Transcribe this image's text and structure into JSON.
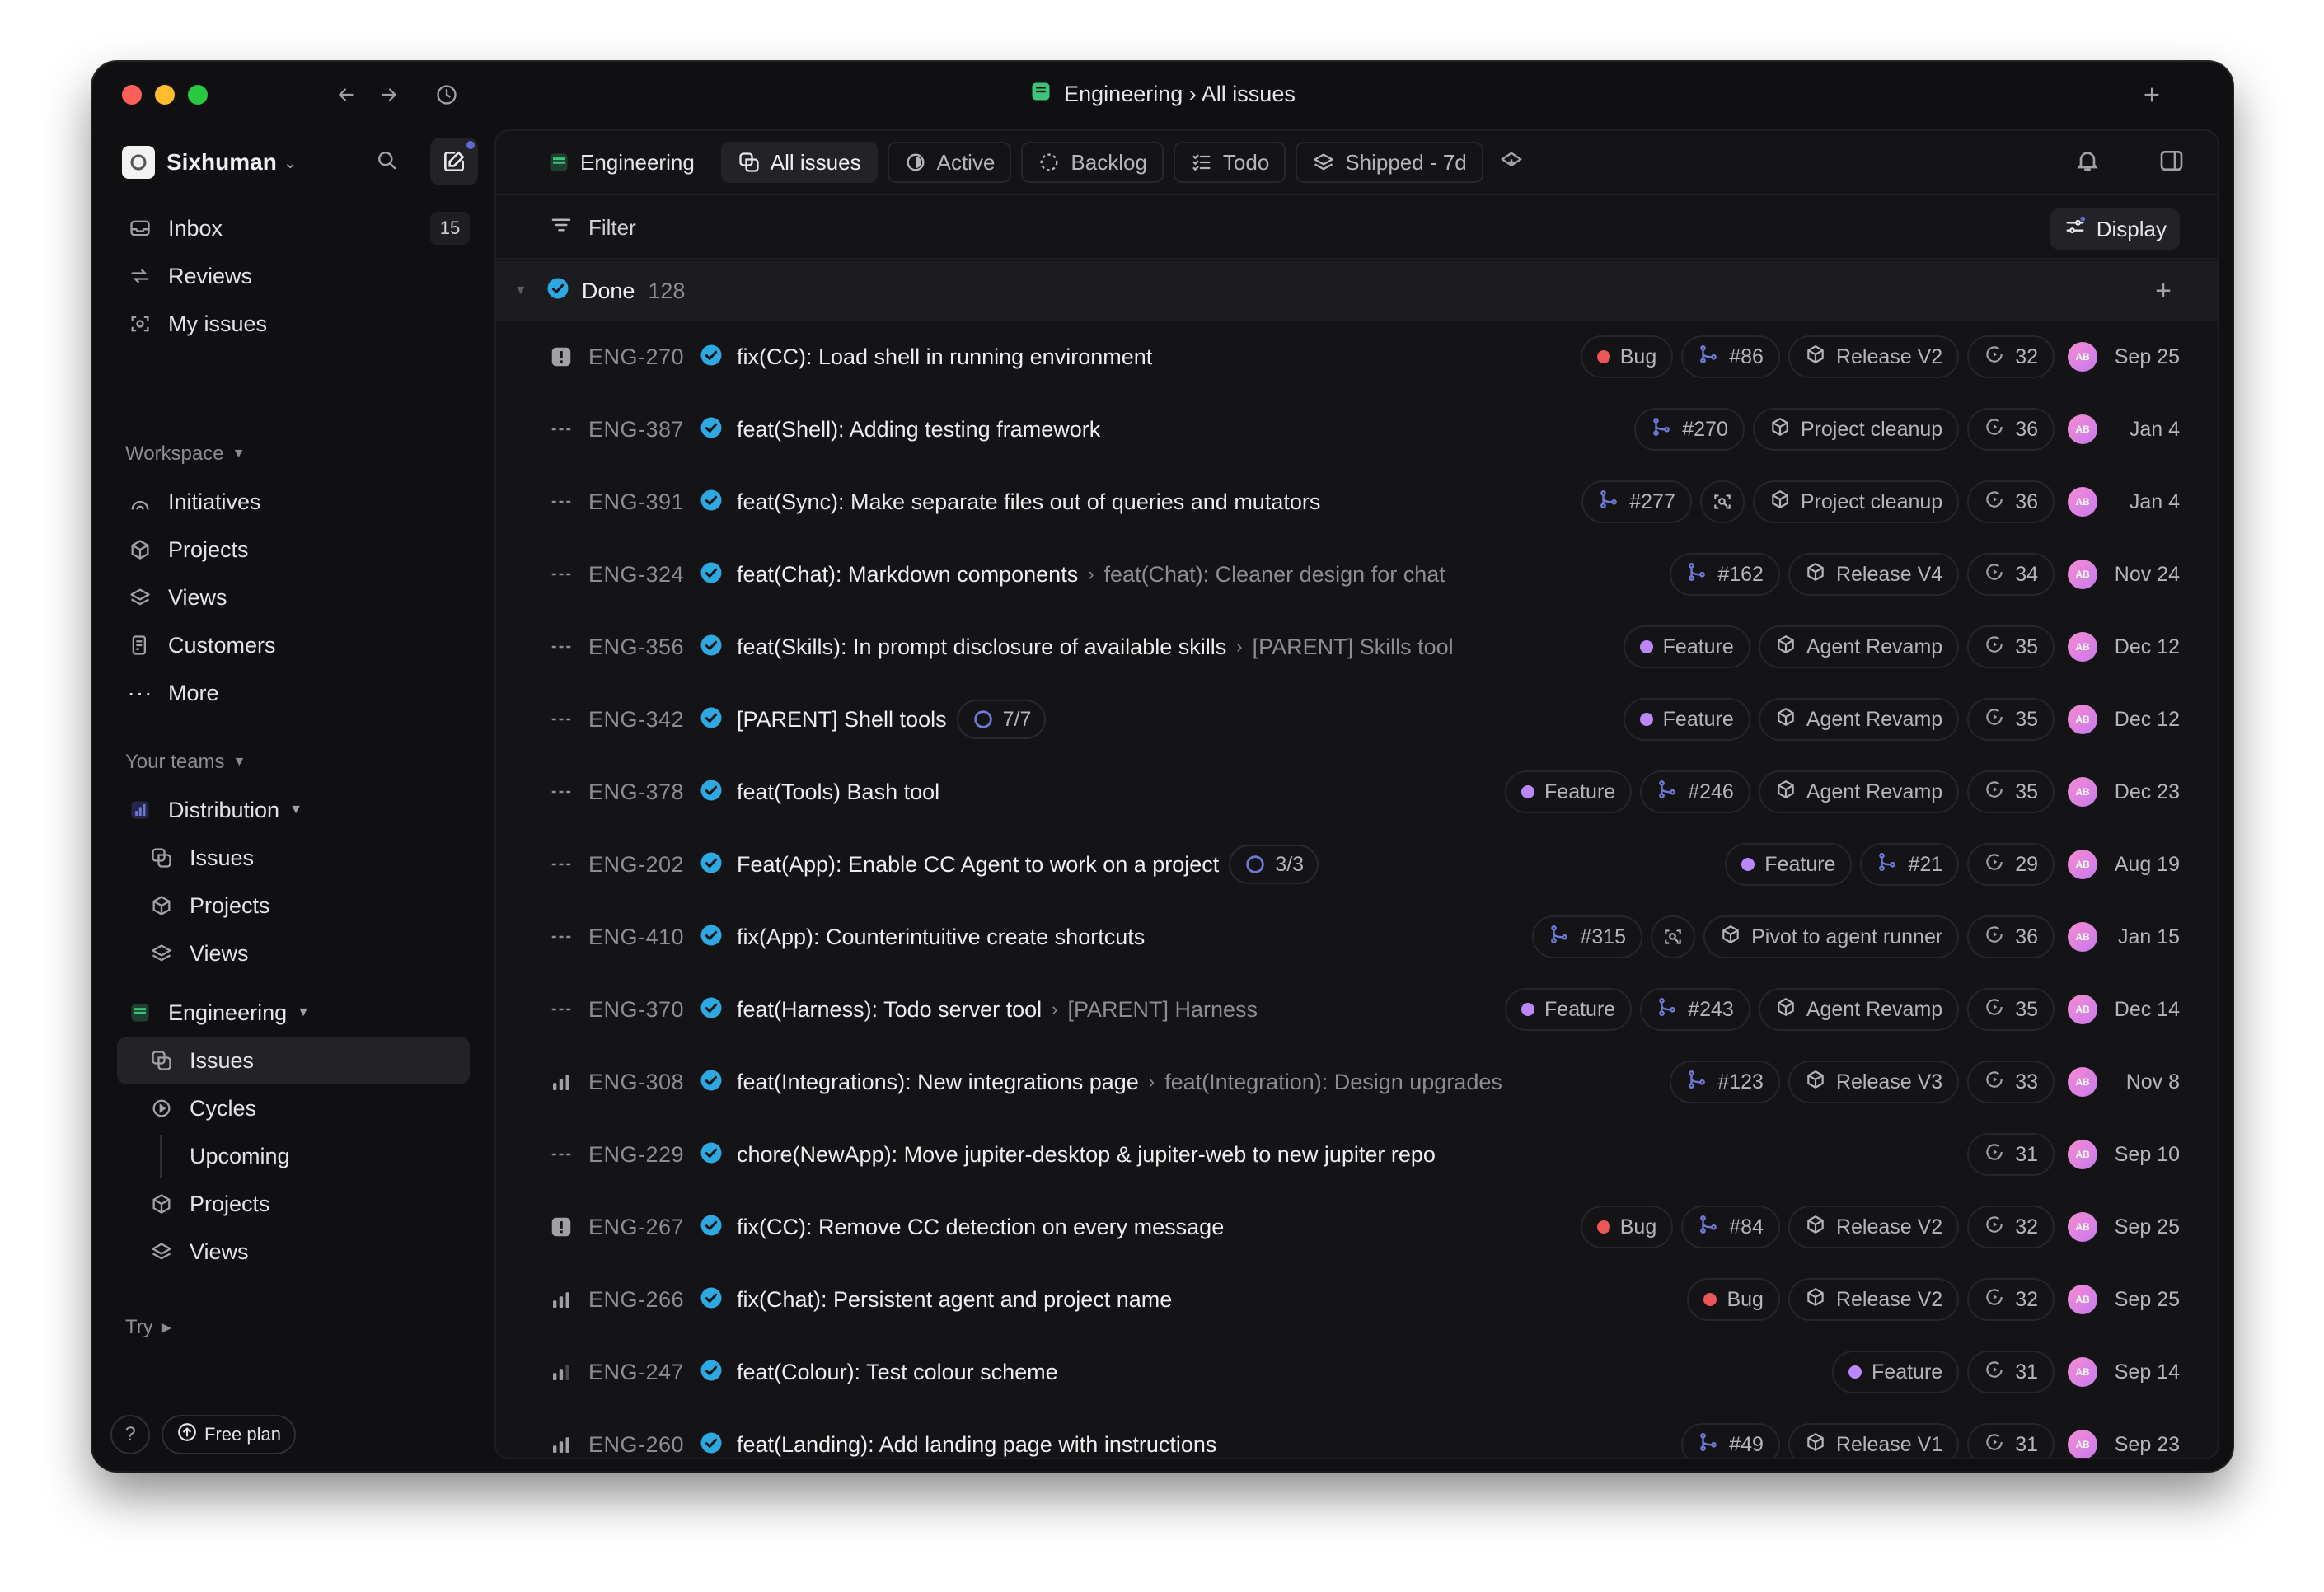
{
  "window": {
    "title_team": "Engineering",
    "title_sep": "›",
    "title_view": "All issues"
  },
  "sidebar": {
    "workspace_name": "Sixhuman",
    "top_items": [
      {
        "label": "Inbox",
        "count": "15"
      },
      {
        "label": "Reviews"
      },
      {
        "label": "My issues"
      }
    ],
    "workspace_header": "Workspace",
    "workspace_items": [
      "Initiatives",
      "Projects",
      "Views",
      "Customers",
      "More"
    ],
    "teams_header": "Your teams",
    "distribution": {
      "label": "Distribution",
      "items": [
        "Issues",
        "Projects",
        "Views"
      ]
    },
    "engineering": {
      "label": "Engineering",
      "items": [
        "Issues",
        "Cycles",
        "Upcoming",
        "Projects",
        "Views"
      ]
    },
    "try_label": "Try",
    "help_label": "?",
    "plan_label": "Free plan"
  },
  "tabs": {
    "team": "Engineering",
    "items": [
      "All issues",
      "Active",
      "Backlog",
      "Todo",
      "Shipped - 7d"
    ]
  },
  "filterbar": {
    "filter_label": "Filter",
    "display_label": "Display"
  },
  "group": {
    "label": "Done",
    "count": "128"
  },
  "colors": {
    "accent": "#5e6ad2",
    "done": "#2ea8e0",
    "bug": "#eb5757",
    "feature": "#bb87fc",
    "pr": "#6e79d6"
  },
  "issues": [
    {
      "priority": "urgent",
      "id": "ENG-270",
      "title": "fix(CC): Load shell in running environment",
      "label": "Bug",
      "label_color": "#eb5757",
      "pr": "#86",
      "project": "Release V2",
      "cycle": "32",
      "avatar": "AB",
      "date": "Sep 25"
    },
    {
      "priority": "none",
      "id": "ENG-387",
      "title": "feat(Shell): Adding testing framework",
      "pr": "#270",
      "project": "Project cleanup",
      "cycle": "36",
      "avatar": "AB",
      "date": "Jan 4"
    },
    {
      "priority": "none",
      "id": "ENG-391",
      "title": "feat(Sync): Make separate files out of queries and mutators",
      "pr": "#277",
      "review": true,
      "project": "Project cleanup",
      "cycle": "36",
      "avatar": "AB",
      "date": "Jan 4"
    },
    {
      "priority": "none",
      "id": "ENG-324",
      "title": "feat(Chat): Markdown components",
      "parent": "feat(Chat): Cleaner design for chat",
      "pr": "#162",
      "project": "Release V4",
      "cycle": "34",
      "avatar": "AB",
      "date": "Nov 24"
    },
    {
      "priority": "none",
      "id": "ENG-356",
      "title": "feat(Skills): In prompt disclosure of available skills",
      "parent": "[PARENT] Skills tool",
      "label": "Feature",
      "label_color": "#bb87fc",
      "project": "Agent Revamp",
      "cycle": "35",
      "avatar": "AB",
      "date": "Dec 12"
    },
    {
      "priority": "none",
      "id": "ENG-342",
      "title": "[PARENT] Shell tools",
      "subcount": "7/7",
      "label": "Feature",
      "label_color": "#bb87fc",
      "project": "Agent Revamp",
      "cycle": "35",
      "avatar": "AB",
      "date": "Dec 12"
    },
    {
      "priority": "none",
      "id": "ENG-378",
      "title": "feat(Tools) Bash tool",
      "label": "Feature",
      "label_color": "#bb87fc",
      "pr": "#246",
      "project": "Agent Revamp",
      "cycle": "35",
      "avatar": "AB",
      "date": "Dec 23"
    },
    {
      "priority": "none",
      "id": "ENG-202",
      "title": "Feat(App): Enable CC Agent to work on a project",
      "subcount": "3/3",
      "label": "Feature",
      "label_color": "#bb87fc",
      "pr": "#21",
      "cycle": "29",
      "avatar": "AB",
      "date": "Aug 19"
    },
    {
      "priority": "none",
      "id": "ENG-410",
      "title": "fix(App): Counterintuitive create shortcuts",
      "pr": "#315",
      "review": true,
      "project": "Pivot to agent runner",
      "cycle": "36",
      "avatar": "AB",
      "date": "Jan 15"
    },
    {
      "priority": "none",
      "id": "ENG-370",
      "title": "feat(Harness): Todo server tool",
      "parent": "[PARENT] Harness",
      "label": "Feature",
      "label_color": "#bb87fc",
      "pr": "#243",
      "project": "Agent Revamp",
      "cycle": "35",
      "avatar": "AB",
      "date": "Dec 14"
    },
    {
      "priority": "high",
      "id": "ENG-308",
      "title": "feat(Integrations): New integrations page",
      "parent": "feat(Integration): Design upgrades",
      "pr": "#123",
      "project": "Release V3",
      "cycle": "33",
      "avatar": "AB",
      "date": "Nov 8"
    },
    {
      "priority": "none",
      "id": "ENG-229",
      "title": "chore(NewApp): Move jupiter-desktop & jupiter-web to new jupiter repo",
      "cycle": "31",
      "avatar": "AB",
      "date": "Sep 10"
    },
    {
      "priority": "urgent",
      "id": "ENG-267",
      "title": "fix(CC): Remove CC detection on every message",
      "label": "Bug",
      "label_color": "#eb5757",
      "pr": "#84",
      "project": "Release V2",
      "cycle": "32",
      "avatar": "AB",
      "date": "Sep 25"
    },
    {
      "priority": "high",
      "id": "ENG-266",
      "title": "fix(Chat): Persistent agent and project name",
      "label": "Bug",
      "label_color": "#eb5757",
      "project": "Release V2",
      "cycle": "32",
      "avatar": "AB",
      "date": "Sep 25"
    },
    {
      "priority": "medium",
      "id": "ENG-247",
      "title": "feat(Colour): Test colour scheme",
      "label": "Feature",
      "label_color": "#bb87fc",
      "cycle": "31",
      "avatar": "AB",
      "date": "Sep 14"
    },
    {
      "priority": "high",
      "id": "ENG-260",
      "title": "feat(Landing): Add landing page with instructions",
      "pr": "#49",
      "project": "Release V1",
      "cycle": "31",
      "avatar": "AB",
      "date": "Sep 23"
    }
  ]
}
